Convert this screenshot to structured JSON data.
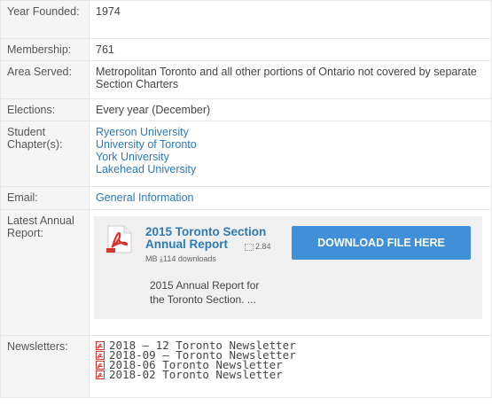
{
  "rows": {
    "year": {
      "label": "Year Founded:",
      "value": "1974"
    },
    "membership": {
      "label": "Membership:",
      "value": "761"
    },
    "area": {
      "label": "Area Served:",
      "value": "Metropolitan Toronto and all other portions of Ontario not covered by separate Section Charters"
    },
    "elections": {
      "label": "Elections:",
      "value": "Every year (December)"
    },
    "student": {
      "label": "Student Chapter(s):",
      "links": [
        "Ryerson University",
        "University of Toronto",
        "York University",
        "Lakehead University"
      ]
    },
    "email": {
      "label": "Email:",
      "link": "General Information"
    },
    "report": {
      "label": "Latest Annual Report:",
      "file_title": "2015 Toronto Section Annual Report",
      "file_size": "2.84",
      "file_size_unit": "MB",
      "downloads": "114 downloads",
      "download_button": "DOWNLOAD FILE HERE",
      "description": "2015 Annual Report for the Toronto Section. ..."
    },
    "newsletters": {
      "label": "Newsletters:",
      "items": [
        "2018 – 12 Toronto Newsletter",
        "2018-09 – Toronto Newsletter",
        "2018-06 Toronto Newsletter",
        "2018-02 Toronto Newsletter"
      ]
    }
  },
  "colors": {
    "link": "#2b7ab8",
    "button": "#3f8fd9",
    "label_bg": "#f5f5f5",
    "file_box_bg": "#f0f0f0",
    "pdf_red": "#d9342b"
  },
  "icons": {
    "file": "pdf-icon",
    "newsletter": "pdf-icon",
    "downloads": "download-icon",
    "size": "grid-icon"
  }
}
